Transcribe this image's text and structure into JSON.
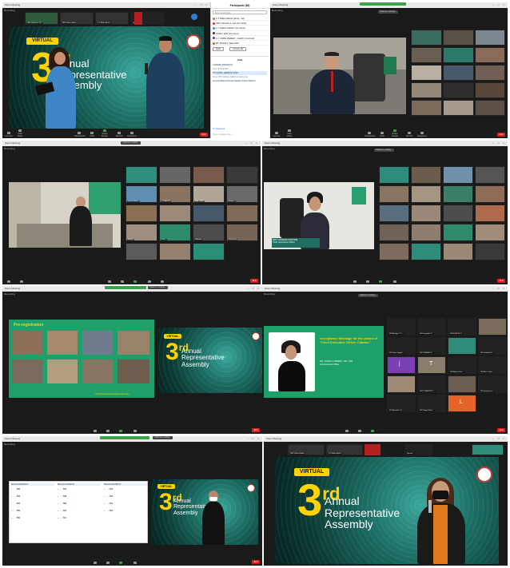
{
  "colors": {
    "zoom_green": "#3aa34b",
    "end_red": "#e02020",
    "stage_teal": "#1b6d63",
    "virtual_yellow": "#ffd200"
  },
  "window_title": "Zoom Meeting",
  "recording": "Recording",
  "tl": {
    "speaker_tiles": [
      "VRV Victoria L. G...",
      "WW Jefeus Balan",
      "1-7 Mabu Bautu"
    ],
    "spinner": "Spinner",
    "virtual": "VIRTUAL",
    "ordinal": "3",
    "ordinal_suffix": "rd",
    "assembly_line1": "Annual",
    "assembly_line2": "Representative",
    "assembly_line3": "Assembly",
    "toolbar": [
      "Unmute",
      "Start Video",
      "Participants",
      "Chat",
      "Share Screen",
      "Record",
      "Reactions"
    ]
  },
  "participants_panel": {
    "title": "Participants (68)",
    "search": "Find a participant",
    "people": [
      "1-7 Mabu Bautu (Host, me)",
      "VRV Victoria L. Ga (Co-host)",
      "1-7 Mabel Fabian (Co-host)",
      "CMAC WW (Co-host)",
      "1-7 JOBS PEREZ - 14e50 (Co-host)",
      "RT Rosell J. Marshall"
    ],
    "buttons": [
      "Invite",
      "Unmute Me"
    ],
    "chat_title": "Chat",
    "chat_lines": [
      "CARMEN BRANDON",
      "From 1TS JOSH: ...",
      "ST1 MARK HERMON KAIN",
      "From VRV Jeibtan Kabbit to Everyone:",
      "Jenessa Baiwa Ronald Saqalm Palors Marked"
    ],
    "to_label": "To: Everyone",
    "type_placeholder": "Type message here..."
  },
  "tr": {
    "options_tab": "Options 1 setting...",
    "toolbar": [
      "Unmute",
      "Start Video",
      "Participants",
      "Chat",
      "Share Screen",
      "Record",
      "Reactions"
    ]
  },
  "ml": {
    "options_tab": "Options 1 setting...",
    "tile_names": [
      "Jessa Villarn...",
      "CORAZON",
      "MAY CRUZ",
      "Evelyn...",
      "Marivic",
      "Lina...",
      "Rolando",
      "Roy Serno"
    ]
  },
  "mr": {
    "options_tab": "Options 1 setting...",
    "speaker_name": "MRS. ROMERA CRISTINE",
    "speaker_role": "Chief Operations Officer"
  },
  "slide_preregistration": "Pre-registration",
  "slide_caption": "3rd Annual Representative Assembly",
  "award": {
    "title": "Acceptance Message for the Award of \"Chief Executive Officer Citation\"",
    "name": "MS. JOSIE O. PEREZ, CPA, MM",
    "role": "Chief Executive Officer"
  },
  "gallery_names": [
    "004 Arselyn T. C...",
    "004 marydeth Y...",
    "004 ELEONI C...",
    "005 Gina Sagala...",
    "001 PLEASE Q...",
    "001 Soledad S. ...",
    "004 Ronnie Ret...",
    "004 Chery V...",
    "004 Alona Vosa...",
    "004 Mo. Lenko...",
    "004 CORAZON T...",
    "001 josephine e...",
    "010 Annabel Co...",
    "001 Regiel Hem...",
    "004 Alana..."
  ],
  "mini_initials": [
    "j",
    "T",
    "L"
  ],
  "slide_table": {
    "headers": [
      "BLOCK DISTRICT",
      "BLOCK DISTRICT",
      "BLOCK DISTRICT"
    ],
    "nums": [
      "502",
      "503",
      "504",
      "505",
      "506",
      "507",
      "508",
      "509",
      "510",
      "511",
      "512",
      "513",
      "514",
      "515"
    ]
  },
  "br": {
    "speaker_tiles": [
      "VRV Jefeus Balan",
      "1-7 Mabu Bautu"
    ],
    "spinner": "Spinner",
    "virtual": "VIRTUAL",
    "ordinal": "3",
    "ordinal_suffix": "rd",
    "assembly_line1": "Annual",
    "assembly_line2": "Representative",
    "assembly_line3": "Assembly"
  }
}
